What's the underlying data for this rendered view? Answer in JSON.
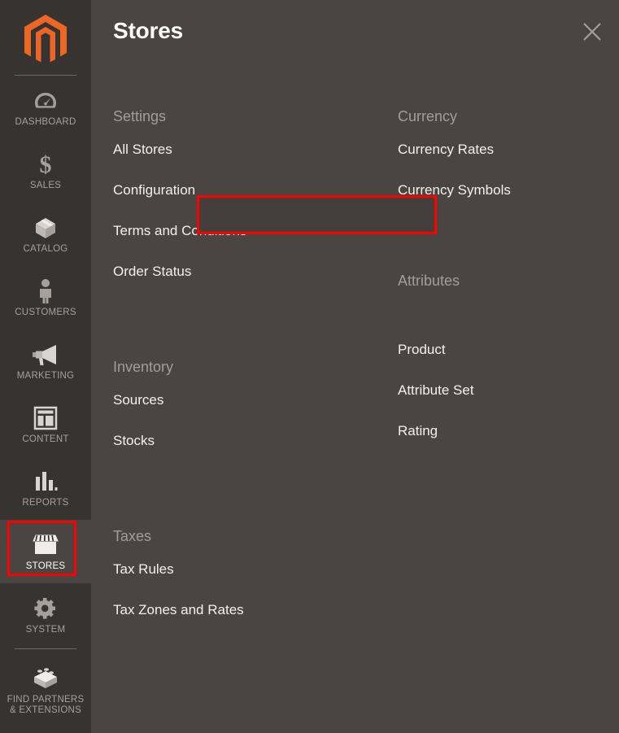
{
  "sidebar": {
    "logo": "magento-logo-icon",
    "items": [
      {
        "label": "DASHBOARD",
        "icon": "dashboard-gauge-icon",
        "active": false
      },
      {
        "label": "SALES",
        "icon": "dollar-sign-icon",
        "active": false
      },
      {
        "label": "CATALOG",
        "icon": "box-icon",
        "active": false
      },
      {
        "label": "CUSTOMERS",
        "icon": "person-icon",
        "active": false
      },
      {
        "label": "MARKETING",
        "icon": "megaphone-icon",
        "active": false
      },
      {
        "label": "CONTENT",
        "icon": "layout-page-icon",
        "active": false
      },
      {
        "label": "REPORTS",
        "icon": "bar-chart-icon",
        "active": false
      },
      {
        "label": "STORES",
        "icon": "storefront-icon",
        "active": true
      },
      {
        "label": "SYSTEM",
        "icon": "gear-icon",
        "active": false
      },
      {
        "label": "FIND PARTNERS\n& EXTENSIONS",
        "label_line1": "FIND PARTNERS",
        "label_line2": "& EXTENSIONS",
        "icon": "lego-brick-icon",
        "active": false
      }
    ]
  },
  "panel": {
    "title": "Stores",
    "close_icon": "close-x-icon",
    "left_column": [
      {
        "group": "Settings",
        "items": [
          "All Stores",
          "Configuration",
          "Terms and Conditions",
          "Order Status"
        ]
      },
      {
        "group": "Inventory",
        "items": [
          "Sources",
          "Stocks"
        ]
      },
      {
        "group": "Taxes",
        "items": [
          "Tax Rules",
          "Tax Zones and Rates"
        ]
      }
    ],
    "right_column": [
      {
        "group": "Currency",
        "items": [
          "Currency Rates",
          "Currency Symbols"
        ]
      },
      {
        "group": "Attributes",
        "items": [
          "Product",
          "Attribute Set",
          "Rating"
        ]
      }
    ]
  },
  "highlights": {
    "color": "#ff0000",
    "targets": [
      "sidebar-item-stores",
      "menu-link-configuration"
    ]
  },
  "colors": {
    "sidebar_bg": "#373330",
    "panel_bg": "#4a4542",
    "active_bg": "#4a4542",
    "accent_orange": "#ec6726",
    "label_muted": "#a39d99",
    "link_text": "#f2f0ef",
    "highlight_red": "#ff0000"
  }
}
